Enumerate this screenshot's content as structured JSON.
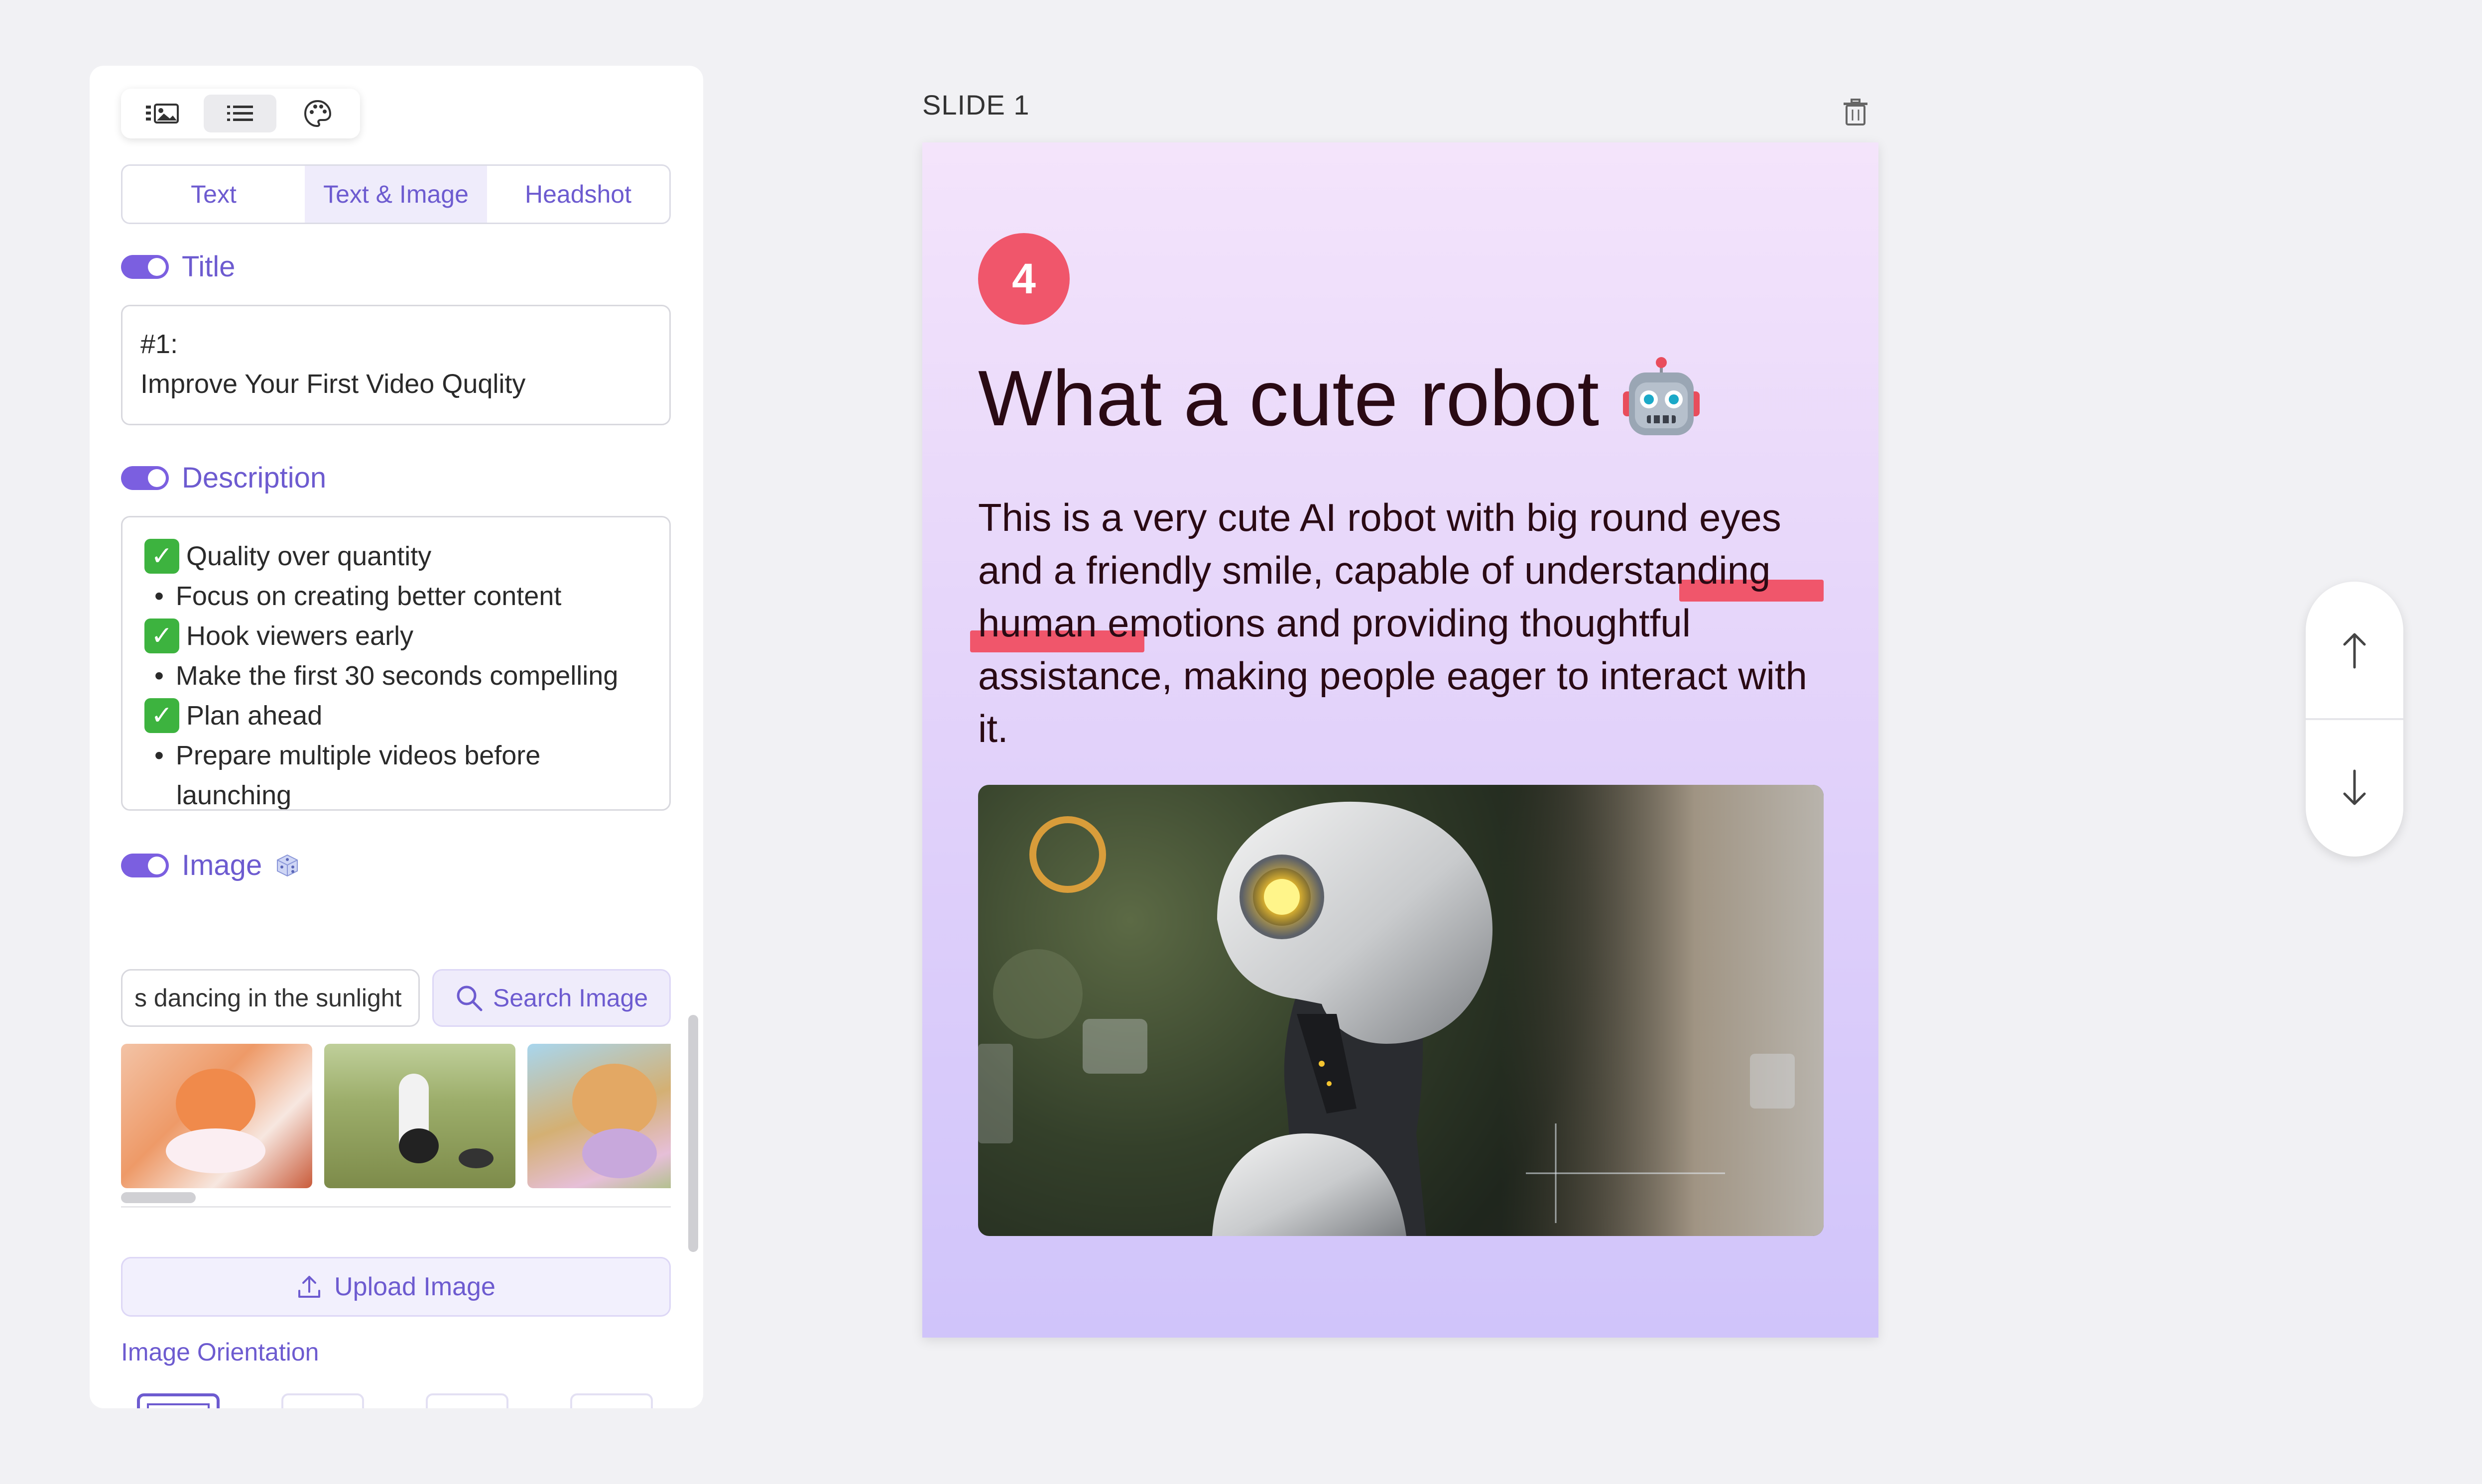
{
  "toolbar": {
    "view_icons": [
      "layout-image-icon",
      "list-icon",
      "palette-icon"
    ],
    "active_view": "list-icon"
  },
  "tabs": [
    {
      "label": "Text",
      "active": false
    },
    {
      "label": "Text & Image",
      "active": true
    },
    {
      "label": "Headshot",
      "active": false
    }
  ],
  "title_section": {
    "label": "Title",
    "enabled": true,
    "lines": [
      "#1:",
      "Improve Your First Video Quqlity"
    ]
  },
  "description_section": {
    "label": "Description",
    "enabled": true,
    "items": [
      {
        "type": "check",
        "text": "Quality over quantity"
      },
      {
        "type": "bullet",
        "text": "Focus on creating better content"
      },
      {
        "type": "check",
        "text": "Hook viewers early"
      },
      {
        "type": "bullet",
        "text": "Make the first 30 seconds compelling"
      },
      {
        "type": "check",
        "text": "Plan ahead"
      },
      {
        "type": "bullet",
        "text": "Prepare multiple videos before"
      },
      {
        "type": "continuation",
        "text": "launching"
      }
    ]
  },
  "image_section": {
    "label": "Image",
    "enabled": true,
    "search_value": "s dancing in the sunlight",
    "search_button": "Search Image",
    "upload_button": "Upload Image",
    "orientation_label": "Image Orientation",
    "selected_orientation_index": 0
  },
  "slide": {
    "label": "SLIDE 1",
    "number": "4",
    "title": "What a cute robot",
    "body": "This is a very cute AI robot with big round eyes and a friendly smile, capable of understanding human emotions and providing thoughtful assistance, making people eager to interact with it."
  },
  "colors": {
    "accent": "#6d5bd0",
    "badge": "#f0566b",
    "check": "#3db33f"
  }
}
